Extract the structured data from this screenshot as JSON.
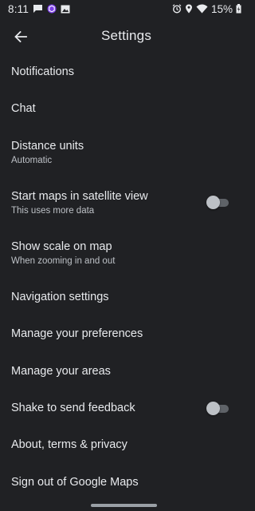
{
  "status_bar": {
    "time": "8:11",
    "battery_percent": "15%",
    "left_icons": [
      "chat-bubble-icon",
      "hexagon-app-icon",
      "image-icon"
    ],
    "right_icons": [
      "alarm-icon",
      "location-icon",
      "wifi-icon",
      "battery-charging-icon"
    ]
  },
  "app_bar": {
    "title": "Settings",
    "back_icon": "arrow-back-icon"
  },
  "settings": [
    {
      "label": "Notifications"
    },
    {
      "label": "Chat"
    },
    {
      "label": "Distance units",
      "subtitle": "Automatic"
    },
    {
      "label": "Start maps in satellite view",
      "subtitle": "This uses more data",
      "toggle": false
    },
    {
      "label": "Show scale on map",
      "subtitle": "When zooming in and out"
    },
    {
      "label": "Navigation settings"
    },
    {
      "label": "Manage your preferences"
    },
    {
      "label": "Manage your areas"
    },
    {
      "label": "Shake to send feedback",
      "toggle": false
    },
    {
      "label": "About, terms & privacy"
    },
    {
      "label": "Sign out of Google Maps"
    }
  ],
  "colors": {
    "background": "#202124",
    "text_primary": "#e8eaed",
    "text_secondary": "#bdc1c6",
    "toggle_off_track": "#5f6368",
    "toggle_off_thumb": "#bdc1c6"
  }
}
